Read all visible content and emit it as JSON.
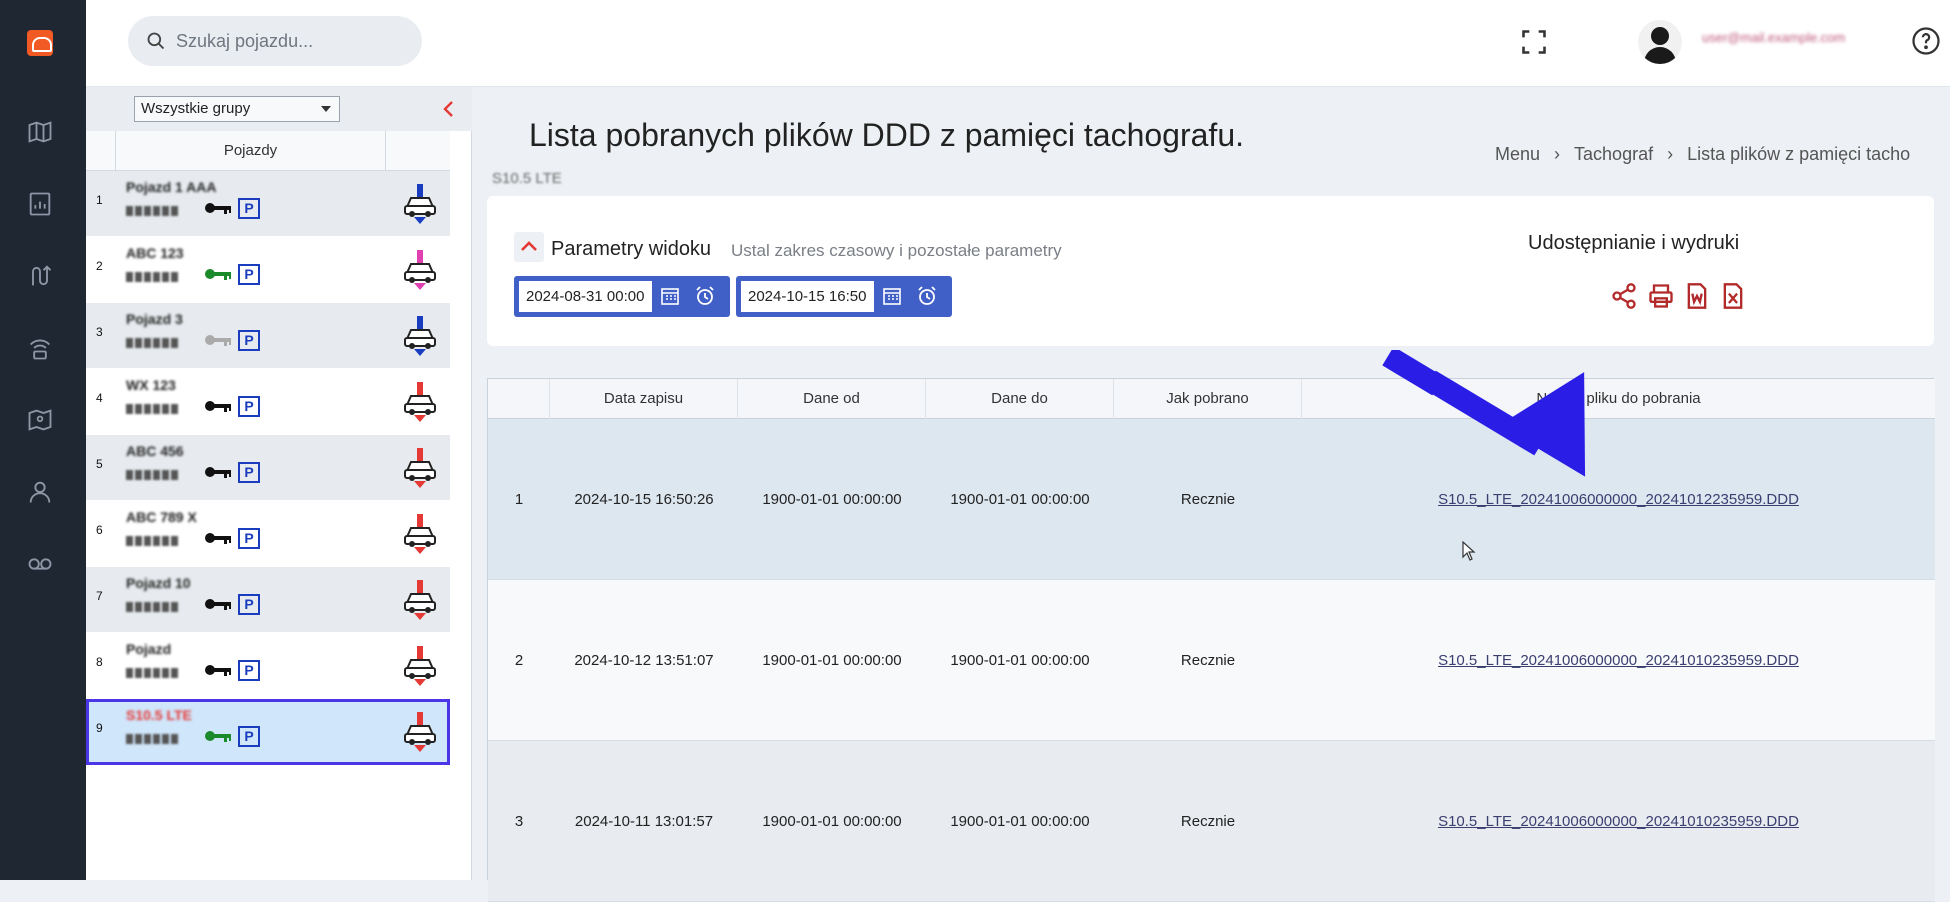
{
  "header": {
    "search_placeholder": "Szukaj pojazdu...",
    "user_name": "user@mail.example.com"
  },
  "vehicles_panel": {
    "group_select": "Wszystkie grupy",
    "column_header": "Pojazdy",
    "items": [
      {
        "index": "1",
        "name": "Pojazd 1 AAA",
        "key_color": "#111111",
        "car_color": "#1a3dbf"
      },
      {
        "index": "2",
        "name": "ABC 123",
        "key_color": "#1a8a2a",
        "car_color": "#e040b0"
      },
      {
        "index": "3",
        "name": "Pojazd 3",
        "key_color": "#aaaaaa",
        "car_color": "#1a3dbf"
      },
      {
        "index": "4",
        "name": "WX 123",
        "key_color": "#111111",
        "car_color": "#e53935"
      },
      {
        "index": "5",
        "name": "ABC 456",
        "key_color": "#111111",
        "car_color": "#e53935"
      },
      {
        "index": "6",
        "name": "ABC 789 X",
        "key_color": "#111111",
        "car_color": "#e53935"
      },
      {
        "index": "7",
        "name": "Pojazd 10",
        "key_color": "#111111",
        "car_color": "#e53935"
      },
      {
        "index": "8",
        "name": "Pojazd",
        "key_color": "#111111",
        "car_color": "#e53935"
      },
      {
        "index": "9",
        "name": "S10.5 LTE",
        "key_color": "#1a8a2a",
        "car_color": "#e53935"
      }
    ]
  },
  "page": {
    "title": "Lista pobranych plików DDD z pamięci tachografu.",
    "subtitle": "S10.5 LTE",
    "breadcrumb": [
      "Menu",
      "Tachograf",
      "Lista plików z pamięci tacho"
    ]
  },
  "params": {
    "title": "Parametry widoku",
    "subtitle": "Ustal zakres czasowy i pozostałe parametry",
    "date_from": "2024-08-31 00:00",
    "date_to": "2024-10-15 16:50",
    "share_title": "Udostępnianie i wydruki"
  },
  "table": {
    "columns": [
      "",
      "Data zapisu",
      "Dane od",
      "Dane do",
      "Jak pobrano",
      "Nazwa pliku do pobrania"
    ],
    "rows": [
      {
        "no": "1",
        "data_zapisu": "2024-10-15 16:50:26",
        "dane_od": "1900-01-01 00:00:00",
        "dane_do": "1900-01-01 00:00:00",
        "jak": "Recznie",
        "plik": "S10.5_LTE_20241006000000_20241012235959.DDD"
      },
      {
        "no": "2",
        "data_zapisu": "2024-10-12 13:51:07",
        "dane_od": "1900-01-01 00:00:00",
        "dane_do": "1900-01-01 00:00:00",
        "jak": "Recznie",
        "plik": "S10.5_LTE_20241006000000_20241010235959.DDD"
      },
      {
        "no": "3",
        "data_zapisu": "2024-10-11 13:01:57",
        "dane_od": "1900-01-01 00:00:00",
        "dane_do": "1900-01-01 00:00:00",
        "jak": "Recznie",
        "plik": "S10.5_LTE_20241006000000_20241010235959.DDD"
      }
    ]
  },
  "colors": {
    "nav_bg": "#1f2732",
    "accent_blue": "#4060c7",
    "share_red": "#b22a2a",
    "annotation_arrow": "#2a1ee6"
  }
}
